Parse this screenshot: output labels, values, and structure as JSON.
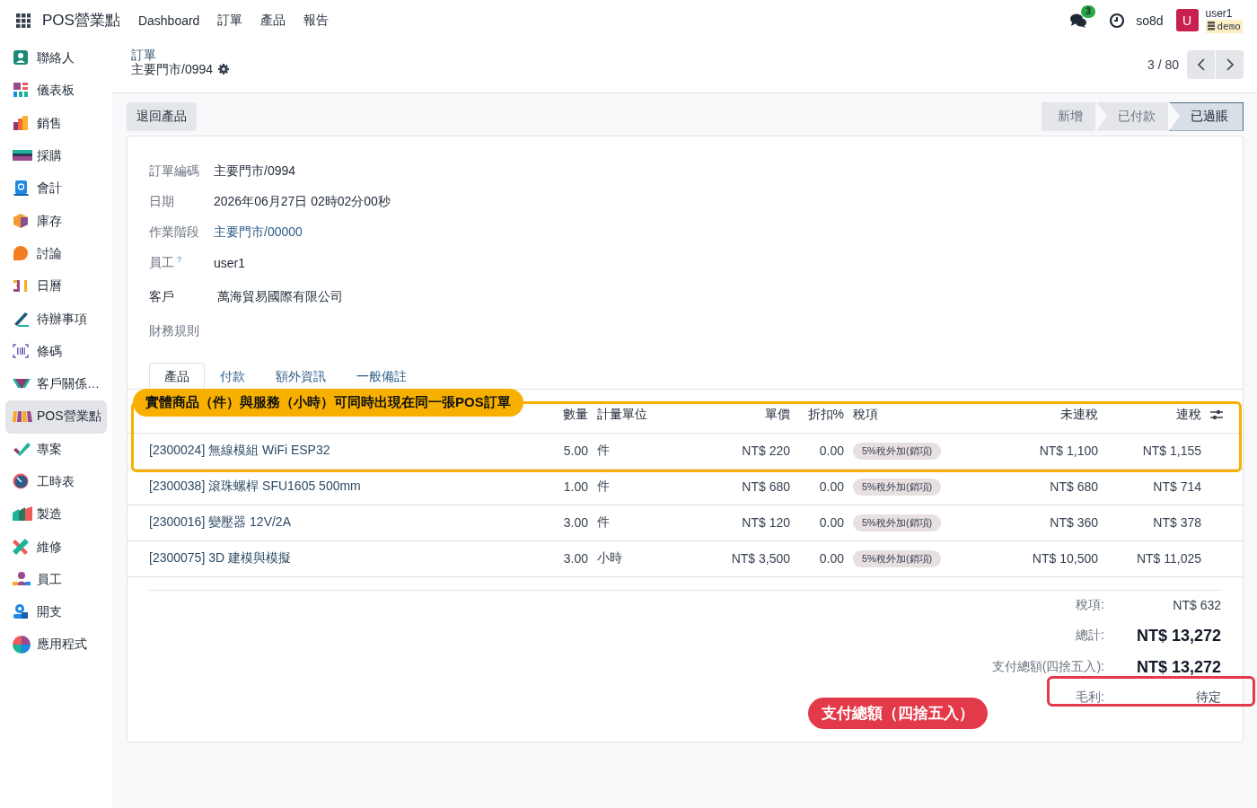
{
  "navbar": {
    "app_name": "POS營業點",
    "menu": [
      "Dashboard",
      "訂單",
      "產品",
      "報告"
    ],
    "messages_badge": "3",
    "company": "so8d",
    "avatar_letter": "U",
    "user": "user1",
    "database": "demo"
  },
  "sidebar": {
    "items": [
      {
        "label": "聯絡人",
        "selected": false
      },
      {
        "label": "儀表板",
        "selected": false
      },
      {
        "label": "銷售",
        "selected": false
      },
      {
        "label": "採購",
        "selected": false
      },
      {
        "label": "會計",
        "selected": false
      },
      {
        "label": "庫存",
        "selected": false
      },
      {
        "label": "討論",
        "selected": false
      },
      {
        "label": "日曆",
        "selected": false
      },
      {
        "label": "待辦事項",
        "selected": false
      },
      {
        "label": "條碼",
        "selected": false
      },
      {
        "label": "客戶關係…",
        "selected": false
      },
      {
        "label": "POS營業點",
        "selected": true
      },
      {
        "label": "專案",
        "selected": false
      },
      {
        "label": "工時表",
        "selected": false
      },
      {
        "label": "製造",
        "selected": false
      },
      {
        "label": "維修",
        "selected": false
      },
      {
        "label": "員工",
        "selected": false
      },
      {
        "label": "開支",
        "selected": false
      },
      {
        "label": "應用程式",
        "selected": false
      }
    ]
  },
  "breadcrumb": {
    "parent": "訂單",
    "current": "主要門市/0994"
  },
  "pager": {
    "text": "3 / 80"
  },
  "actions": [
    "退回產品"
  ],
  "status_bar": [
    {
      "label": "新增",
      "selected": false
    },
    {
      "label": "已付款",
      "selected": false
    },
    {
      "label": "已過賬",
      "selected": true
    }
  ],
  "fields": [
    {
      "label": "訂單編碼",
      "value": "主要門市/0994",
      "kind": "text"
    },
    {
      "label": "日期",
      "value": "2026年06月27日 02時02分00秒",
      "kind": "text"
    },
    {
      "label": "作業階段",
      "value": "主要門市/00000",
      "kind": "link"
    },
    {
      "label": "員工",
      "help": "?",
      "value": "user1",
      "kind": "text"
    },
    {
      "label": "客戶",
      "value": "萬海貿易國際有限公司",
      "kind": "strong"
    },
    {
      "label": "財務規則",
      "kind": "text"
    }
  ],
  "tabs": [
    {
      "label": "產品",
      "selected": true
    },
    {
      "label": "付款",
      "selected": false
    },
    {
      "label": "額外資訊",
      "selected": false
    },
    {
      "label": "一般備註",
      "selected": false
    }
  ],
  "table": {
    "columns": [
      "數量",
      "計量單位",
      "單價",
      "折扣%",
      "稅項",
      "未連稅",
      "連稅"
    ],
    "rows": [
      {
        "product": "[2300024] 無線模組 WiFi ESP32",
        "qty": "5.00",
        "uom": "件",
        "price": "NT$ 220",
        "discount": "0.00",
        "tax": "5%稅外加(銷項)",
        "untaxed": "NT$ 1,100",
        "taxed": "NT$ 1,155"
      },
      {
        "product": "[2300038] 滾珠螺桿 SFU1605 500mm",
        "qty": "1.00",
        "uom": "件",
        "price": "NT$ 680",
        "discount": "0.00",
        "tax": "5%稅外加(銷項)",
        "untaxed": "NT$ 680",
        "taxed": "NT$ 714"
      },
      {
        "product": "[2300016] 變壓器 12V/2A",
        "qty": "3.00",
        "uom": "件",
        "price": "NT$ 120",
        "discount": "0.00",
        "tax": "5%稅外加(銷項)",
        "untaxed": "NT$ 360",
        "taxed": "NT$ 378"
      },
      {
        "product": "[2300075] 3D 建模與模擬",
        "qty": "3.00",
        "uom": "小時",
        "price": "NT$ 3,500",
        "discount": "0.00",
        "tax": "5%稅外加(銷項)",
        "untaxed": "NT$ 10,500",
        "taxed": "NT$ 11,025"
      }
    ]
  },
  "totals": [
    {
      "label": "稅項:",
      "value": "NT$ 632",
      "kind": "plain"
    },
    {
      "label": "總計:",
      "value": "NT$ 13,272",
      "kind": "bold"
    },
    {
      "label": "支付總額(四捨五入):",
      "value": "NT$ 13,272",
      "kind": "bold"
    },
    {
      "label": "毛利:",
      "value": "待定",
      "kind": "plain"
    }
  ],
  "annotations": [
    {
      "text": "實體商品（件）與服務（小時）可同時出現在同一張POS訂單",
      "kind": "rows",
      "color": "#f7b000"
    },
    {
      "text": "支付總額（四捨五入）",
      "kind": "margin",
      "color": "#e33a4a"
    }
  ]
}
